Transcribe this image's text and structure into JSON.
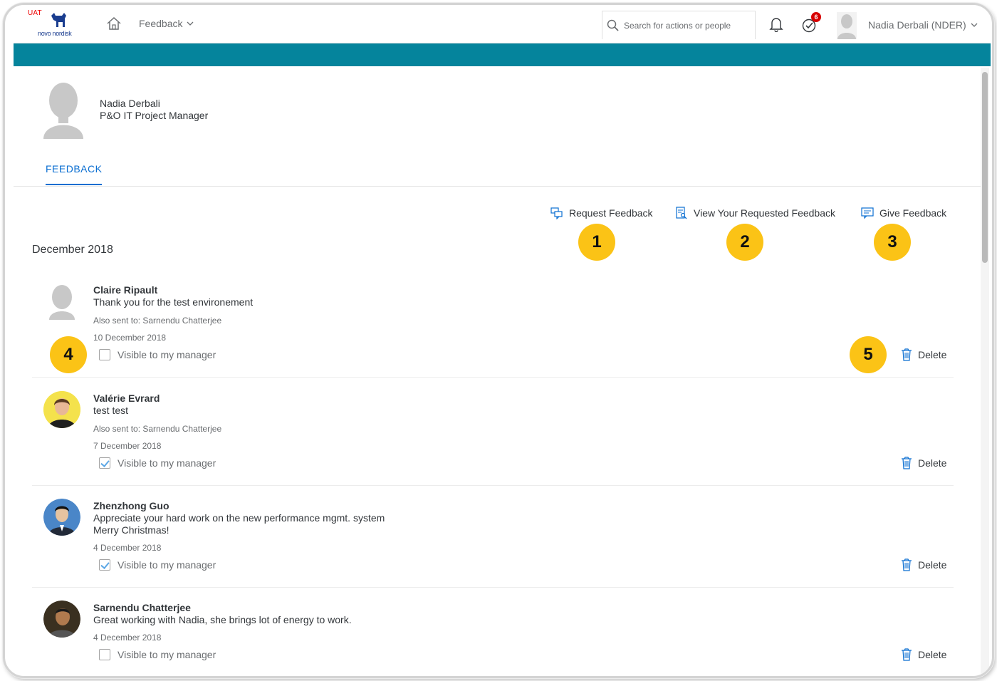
{
  "shell": {
    "env_tag": "UAT",
    "brand": "novo nordisk",
    "app_title": "Feedback",
    "search_placeholder": "Search for actions or people",
    "tasks_badge": "6",
    "user_name": "Nadia Derbali (NDER)"
  },
  "colors": {
    "accent": "#0a6ed1",
    "teal_bar": "#05849c",
    "callout": "#fbc316",
    "badge": "#d70000"
  },
  "profile": {
    "name": "Nadia Derbali",
    "role": "P&O IT Project Manager"
  },
  "tabs": [
    {
      "label": "FEEDBACK",
      "selected": true
    }
  ],
  "actions": {
    "request": "Request Feedback",
    "view": "View Your Requested Feedback",
    "give": "Give Feedback"
  },
  "callouts": [
    "1",
    "2",
    "3",
    "4",
    "5"
  ],
  "month": "December 2018",
  "feedback": [
    {
      "author": "Claire Ripault",
      "message": "Thank you for the test environement",
      "also_sent": "Also sent to: Sarnendu Chatterjee",
      "date": "10 December 2018",
      "visible_label": "Visible to my manager",
      "visible_checked": false,
      "delete_label": "Delete",
      "avatar": "placeholder-silhouette"
    },
    {
      "author": "Valérie Evrard",
      "message": "test test",
      "also_sent": "Also sent to: Sarnendu Chatterjee",
      "date": "7 December 2018",
      "visible_label": "Visible to my manager",
      "visible_checked": true,
      "delete_label": "Delete",
      "avatar": "photo"
    },
    {
      "author": "Zhenzhong Guo",
      "message_line1": "Appreciate your hard work on the new performance mgmt. system",
      "message_line2": "Merry Christmas!",
      "date": "4 December 2018",
      "visible_label": "Visible to my manager",
      "visible_checked": true,
      "delete_label": "Delete",
      "avatar": "photo"
    },
    {
      "author": "Sarnendu Chatterjee",
      "message": "Great working with Nadia, she brings lot of energy to work.",
      "date": "4 December 2018",
      "visible_label": "Visible to my manager",
      "visible_checked": false,
      "delete_label": "Delete",
      "avatar": "photo"
    }
  ]
}
